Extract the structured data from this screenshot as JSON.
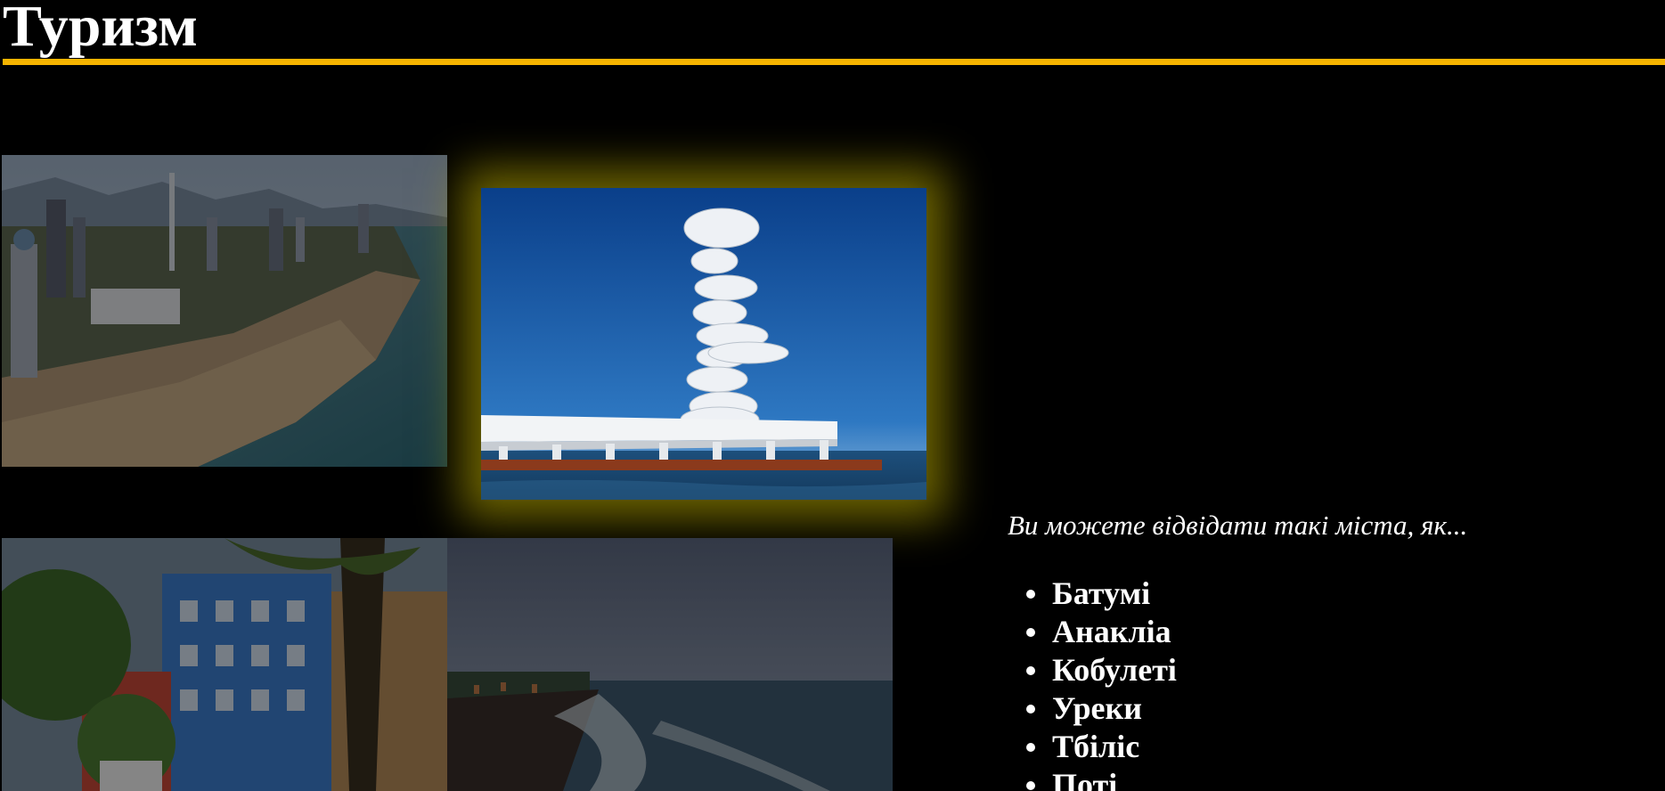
{
  "header": {
    "title": "Туризм",
    "rule_color": "#f6b400"
  },
  "photos": [
    {
      "name": "batumi-coast-photo",
      "subject": "aerial view of Batumi coastline",
      "dimmed": true
    },
    {
      "name": "tower-pier-photo",
      "subject": "white sculptural tower on sea pier",
      "highlighted": true,
      "glow_color": "#c4b400"
    },
    {
      "name": "street-houses-photo",
      "subject": "blue houses with palm trees",
      "dimmed": true
    },
    {
      "name": "beach-evening-photo",
      "subject": "beach shoreline at dusk",
      "dimmed": true
    }
  ],
  "content": {
    "intro": "Ви можете відвідати такі міста, як...",
    "cities": [
      "Батумі",
      "Анакліа",
      "Кобулеті",
      "Уреки",
      "Тбіліс",
      "Поті"
    ]
  }
}
